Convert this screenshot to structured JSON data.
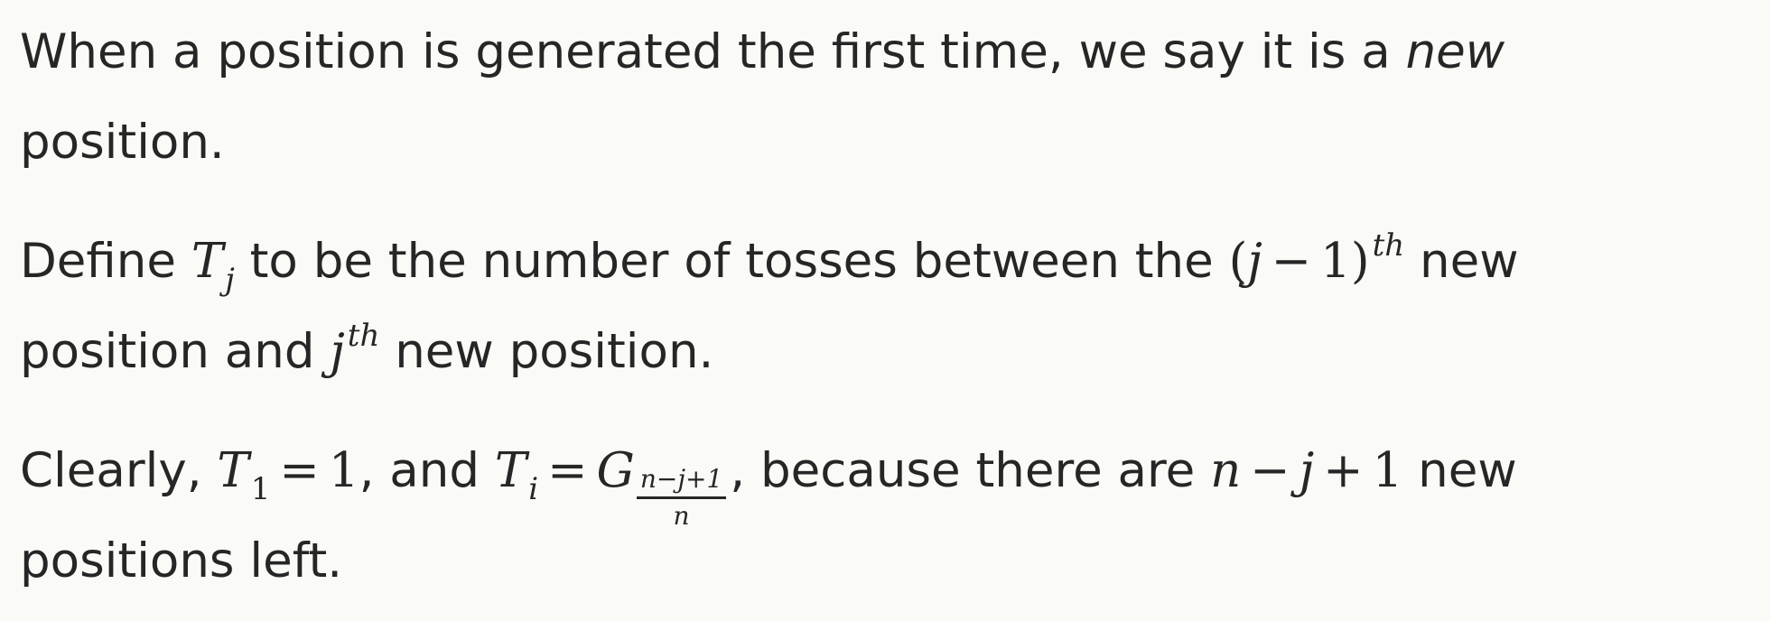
{
  "paragraph1": {
    "line1_text": "When a position is generated the first time, we say it is a",
    "line1_emphasis": "new",
    "line2_text": "position."
  },
  "paragraph2": {
    "pre": "Define",
    "T": "T",
    "T_sub": "j",
    "mid": "to be the number of tosses between the",
    "lparen": "(",
    "j": "j",
    "minus": "−",
    "one": "1",
    "rparen": ")",
    "sup_th": "th",
    "post_line1": "new",
    "line2_pre": "position and",
    "line2_j": "j",
    "line2_sup": "th",
    "line2_post": "new position."
  },
  "paragraph3": {
    "pre": "Clearly,",
    "T1": "T",
    "T1_sub": "1",
    "eq": "=",
    "one": "1",
    "and": ", and",
    "Ti": "T",
    "Ti_sub": "i",
    "eq2": "=",
    "G": "G",
    "frac_num": "n−j+1",
    "frac_den": "n",
    "because": ", because there are",
    "n": "n",
    "minus": "−",
    "j": "j",
    "plus": "+",
    "one_b": "1",
    "post_line1": "new",
    "line2": "positions left."
  }
}
